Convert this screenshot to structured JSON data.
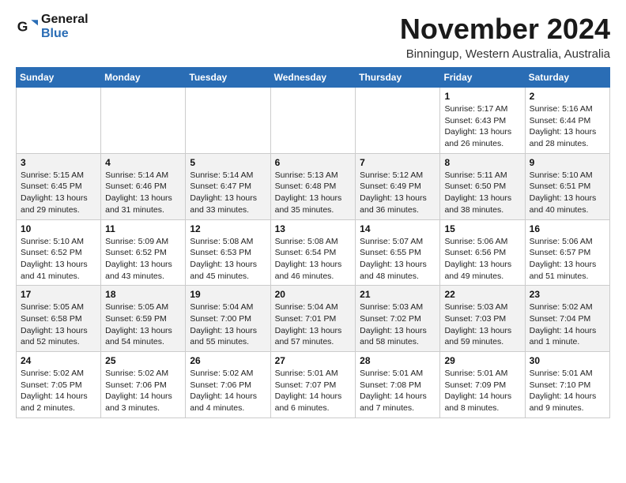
{
  "logo": {
    "line1": "General",
    "line2": "Blue"
  },
  "title": "November 2024",
  "location": "Binningup, Western Australia, Australia",
  "weekdays": [
    "Sunday",
    "Monday",
    "Tuesday",
    "Wednesday",
    "Thursday",
    "Friday",
    "Saturday"
  ],
  "weeks": [
    [
      {
        "day": "",
        "info": ""
      },
      {
        "day": "",
        "info": ""
      },
      {
        "day": "",
        "info": ""
      },
      {
        "day": "",
        "info": ""
      },
      {
        "day": "",
        "info": ""
      },
      {
        "day": "1",
        "info": "Sunrise: 5:17 AM\nSunset: 6:43 PM\nDaylight: 13 hours\nand 26 minutes."
      },
      {
        "day": "2",
        "info": "Sunrise: 5:16 AM\nSunset: 6:44 PM\nDaylight: 13 hours\nand 28 minutes."
      }
    ],
    [
      {
        "day": "3",
        "info": "Sunrise: 5:15 AM\nSunset: 6:45 PM\nDaylight: 13 hours\nand 29 minutes."
      },
      {
        "day": "4",
        "info": "Sunrise: 5:14 AM\nSunset: 6:46 PM\nDaylight: 13 hours\nand 31 minutes."
      },
      {
        "day": "5",
        "info": "Sunrise: 5:14 AM\nSunset: 6:47 PM\nDaylight: 13 hours\nand 33 minutes."
      },
      {
        "day": "6",
        "info": "Sunrise: 5:13 AM\nSunset: 6:48 PM\nDaylight: 13 hours\nand 35 minutes."
      },
      {
        "day": "7",
        "info": "Sunrise: 5:12 AM\nSunset: 6:49 PM\nDaylight: 13 hours\nand 36 minutes."
      },
      {
        "day": "8",
        "info": "Sunrise: 5:11 AM\nSunset: 6:50 PM\nDaylight: 13 hours\nand 38 minutes."
      },
      {
        "day": "9",
        "info": "Sunrise: 5:10 AM\nSunset: 6:51 PM\nDaylight: 13 hours\nand 40 minutes."
      }
    ],
    [
      {
        "day": "10",
        "info": "Sunrise: 5:10 AM\nSunset: 6:52 PM\nDaylight: 13 hours\nand 41 minutes."
      },
      {
        "day": "11",
        "info": "Sunrise: 5:09 AM\nSunset: 6:52 PM\nDaylight: 13 hours\nand 43 minutes."
      },
      {
        "day": "12",
        "info": "Sunrise: 5:08 AM\nSunset: 6:53 PM\nDaylight: 13 hours\nand 45 minutes."
      },
      {
        "day": "13",
        "info": "Sunrise: 5:08 AM\nSunset: 6:54 PM\nDaylight: 13 hours\nand 46 minutes."
      },
      {
        "day": "14",
        "info": "Sunrise: 5:07 AM\nSunset: 6:55 PM\nDaylight: 13 hours\nand 48 minutes."
      },
      {
        "day": "15",
        "info": "Sunrise: 5:06 AM\nSunset: 6:56 PM\nDaylight: 13 hours\nand 49 minutes."
      },
      {
        "day": "16",
        "info": "Sunrise: 5:06 AM\nSunset: 6:57 PM\nDaylight: 13 hours\nand 51 minutes."
      }
    ],
    [
      {
        "day": "17",
        "info": "Sunrise: 5:05 AM\nSunset: 6:58 PM\nDaylight: 13 hours\nand 52 minutes."
      },
      {
        "day": "18",
        "info": "Sunrise: 5:05 AM\nSunset: 6:59 PM\nDaylight: 13 hours\nand 54 minutes."
      },
      {
        "day": "19",
        "info": "Sunrise: 5:04 AM\nSunset: 7:00 PM\nDaylight: 13 hours\nand 55 minutes."
      },
      {
        "day": "20",
        "info": "Sunrise: 5:04 AM\nSunset: 7:01 PM\nDaylight: 13 hours\nand 57 minutes."
      },
      {
        "day": "21",
        "info": "Sunrise: 5:03 AM\nSunset: 7:02 PM\nDaylight: 13 hours\nand 58 minutes."
      },
      {
        "day": "22",
        "info": "Sunrise: 5:03 AM\nSunset: 7:03 PM\nDaylight: 13 hours\nand 59 minutes."
      },
      {
        "day": "23",
        "info": "Sunrise: 5:02 AM\nSunset: 7:04 PM\nDaylight: 14 hours\nand 1 minute."
      }
    ],
    [
      {
        "day": "24",
        "info": "Sunrise: 5:02 AM\nSunset: 7:05 PM\nDaylight: 14 hours\nand 2 minutes."
      },
      {
        "day": "25",
        "info": "Sunrise: 5:02 AM\nSunset: 7:06 PM\nDaylight: 14 hours\nand 3 minutes."
      },
      {
        "day": "26",
        "info": "Sunrise: 5:02 AM\nSunset: 7:06 PM\nDaylight: 14 hours\nand 4 minutes."
      },
      {
        "day": "27",
        "info": "Sunrise: 5:01 AM\nSunset: 7:07 PM\nDaylight: 14 hours\nand 6 minutes."
      },
      {
        "day": "28",
        "info": "Sunrise: 5:01 AM\nSunset: 7:08 PM\nDaylight: 14 hours\nand 7 minutes."
      },
      {
        "day": "29",
        "info": "Sunrise: 5:01 AM\nSunset: 7:09 PM\nDaylight: 14 hours\nand 8 minutes."
      },
      {
        "day": "30",
        "info": "Sunrise: 5:01 AM\nSunset: 7:10 PM\nDaylight: 14 hours\nand 9 minutes."
      }
    ]
  ]
}
